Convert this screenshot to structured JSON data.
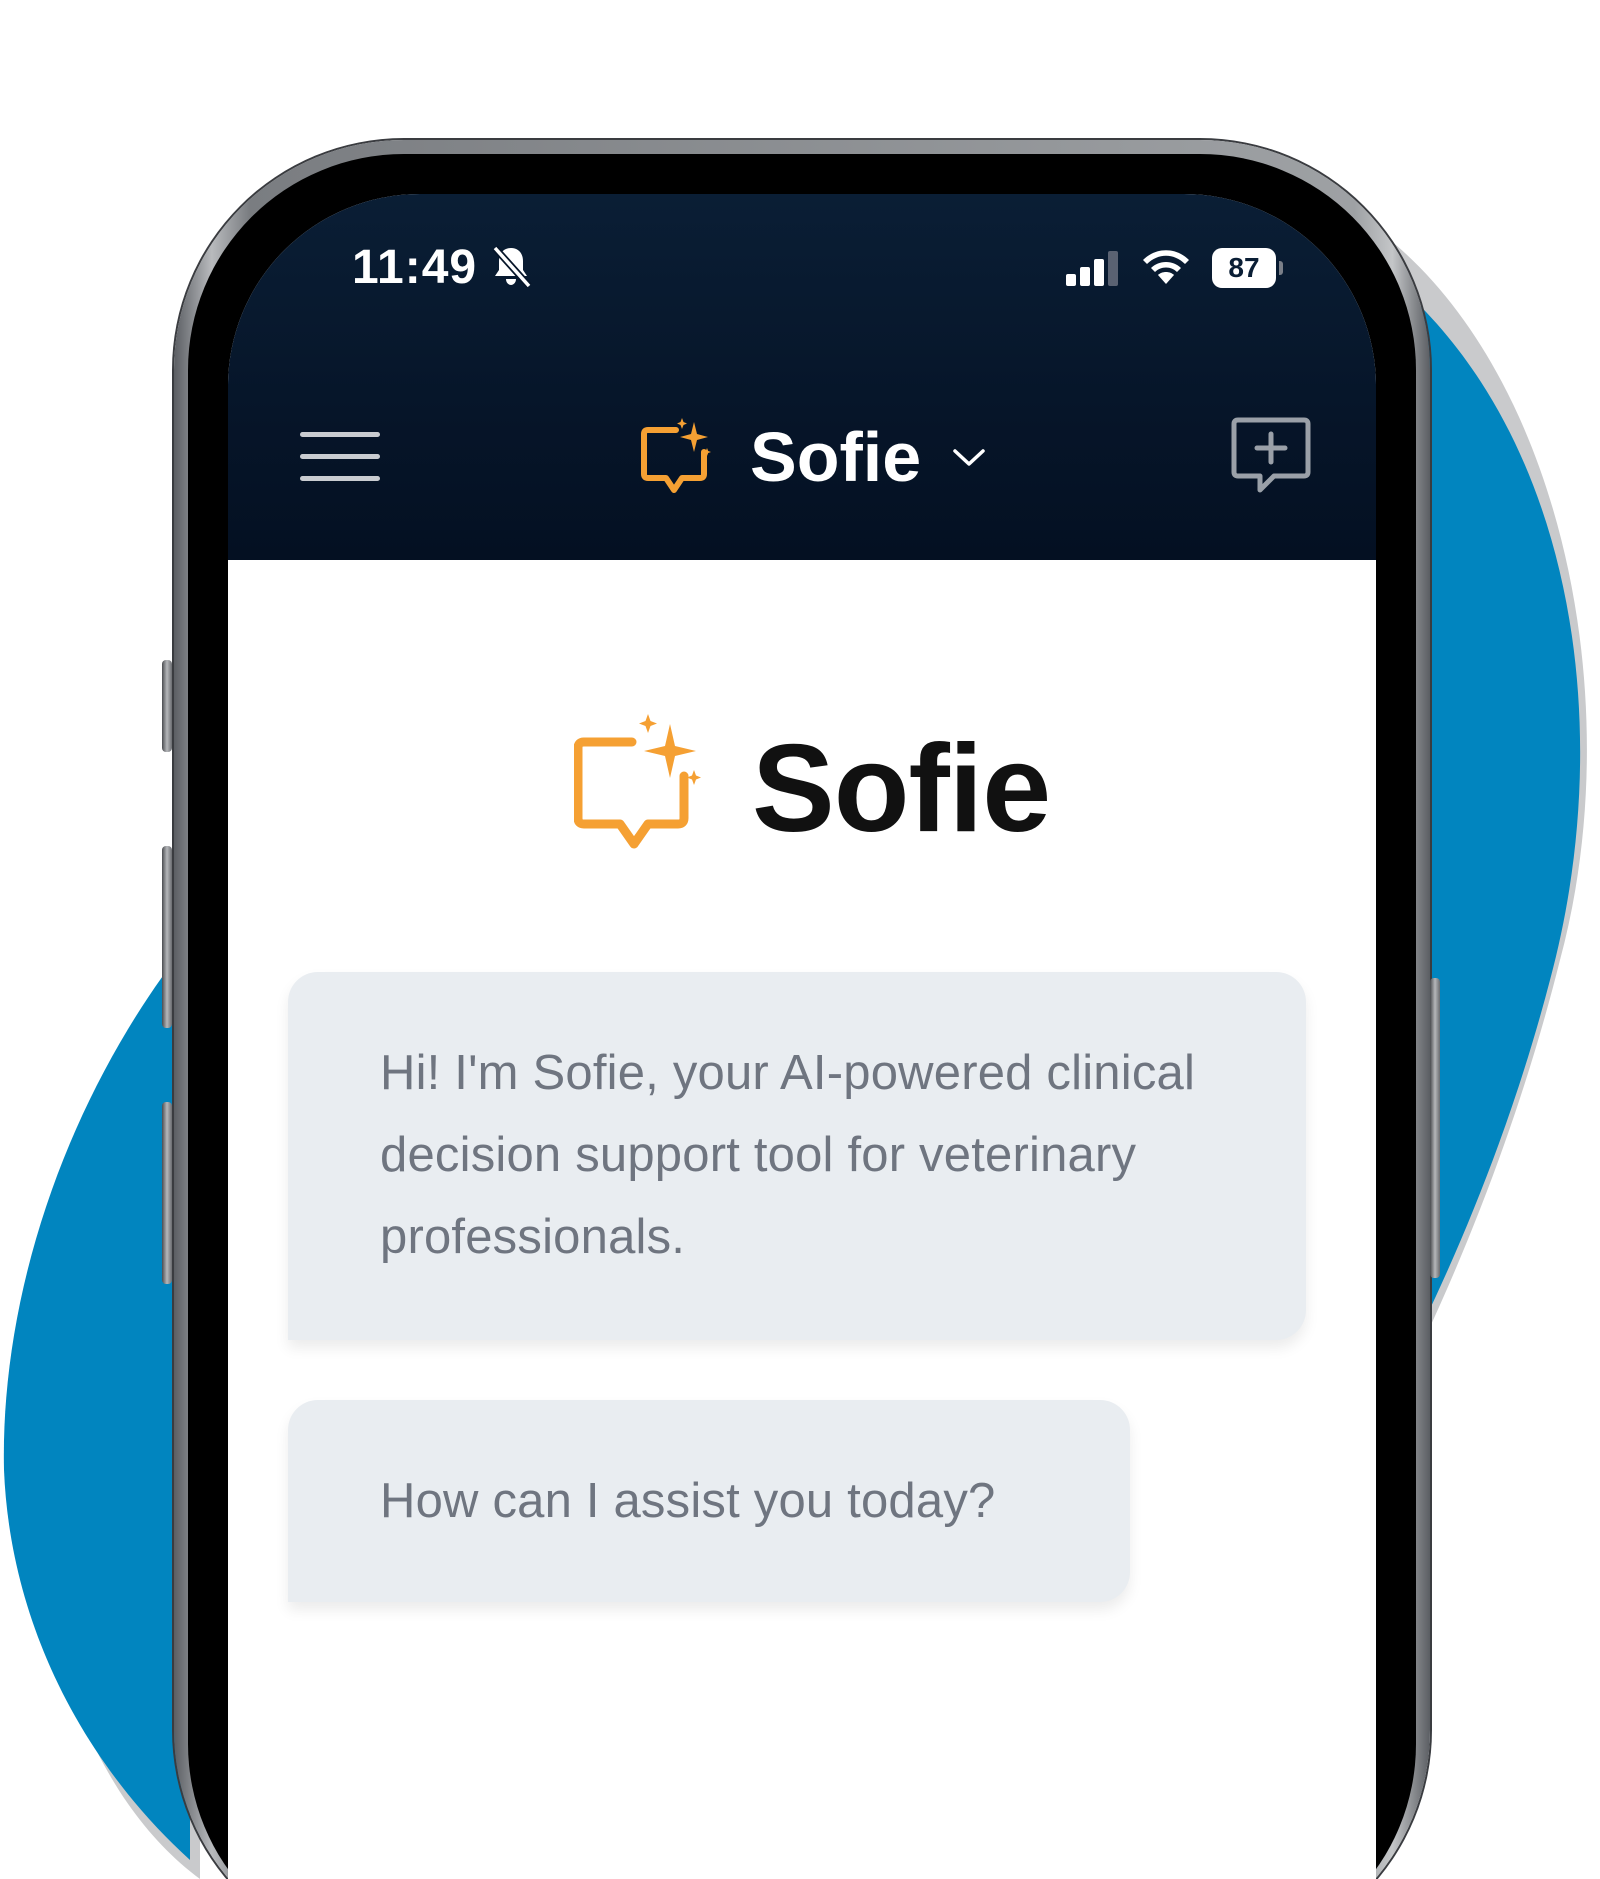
{
  "status_bar": {
    "time": "11:49",
    "battery": "87",
    "icons": [
      "bell-off-icon",
      "signal-icon",
      "wifi-icon",
      "battery-icon"
    ]
  },
  "header": {
    "title": "Sofie",
    "icons": [
      "menu-icon",
      "sofie-logo-icon",
      "chevron-down-icon",
      "new-chat-icon"
    ]
  },
  "brand": {
    "name": "Sofie"
  },
  "messages": [
    {
      "text": "Hi! I'm Sofie, your AI-powered clinical decision support tool for veterinary professionals."
    },
    {
      "text": "How can I assist you today?"
    }
  ],
  "colors": {
    "accent": "#f5a033",
    "header_bg": "#061529",
    "bubble_bg": "#e9edf1",
    "backdrop_blue": "#0185bf"
  }
}
